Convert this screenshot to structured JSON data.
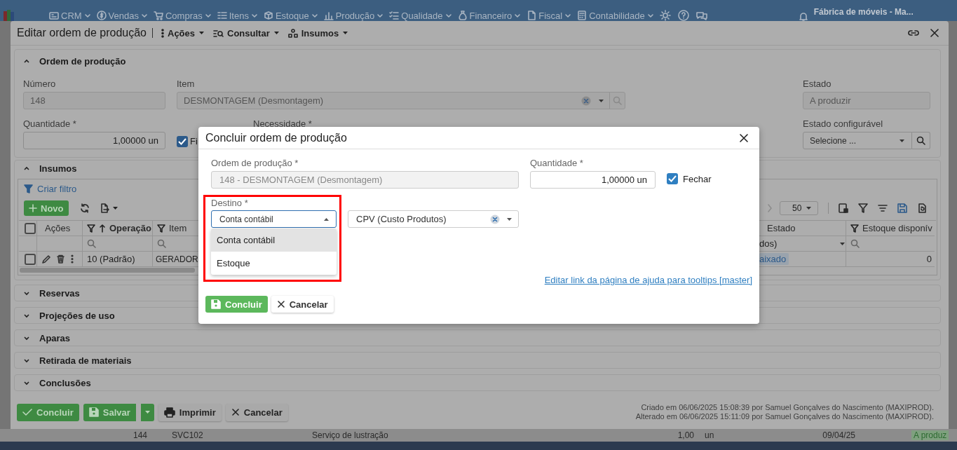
{
  "top_nav": {
    "menu_items": [
      {
        "label": "CRM"
      },
      {
        "label": "Vendas"
      },
      {
        "label": "Compras"
      },
      {
        "label": "Itens"
      },
      {
        "label": "Estoque"
      },
      {
        "label": "Produção"
      },
      {
        "label": "Qualidade"
      },
      {
        "label": "Financeiro"
      },
      {
        "label": "Fiscal"
      },
      {
        "label": "Contabilidade"
      }
    ],
    "company": "Fábrica de móveis - Ma..."
  },
  "window": {
    "title": "Editar ordem de produção",
    "menus": [
      {
        "label": "Ações"
      },
      {
        "label": "Consultar"
      },
      {
        "label": "Insumos"
      }
    ]
  },
  "sections": [
    {
      "title": "Ordem de produção",
      "expanded": true,
      "kind": "order_form",
      "numero": {
        "label": "Número",
        "value": "148"
      },
      "item": {
        "label": "Item",
        "value": "DESMONTAGEM (Desmontagem)"
      },
      "estado": {
        "label": "Estado",
        "value": "A produzir"
      },
      "quantidade": {
        "label": "Quantidade *",
        "value": "1,00000 un"
      },
      "fixed": {
        "label": "Fi",
        "checked": true
      },
      "necessidade": {
        "label": "Necessidade *"
      },
      "estado_configuravel": {
        "label": "Estado configurável",
        "placeholder": "Selecione ..."
      }
    },
    {
      "title": "Insumos",
      "expanded": true,
      "kind": "grid",
      "all_checked": false,
      "filter_link": "Criar filtro",
      "new_button": "Novo",
      "page_size": "50",
      "columns": [
        {
          "label": "Ações",
          "filterable": false,
          "sorted": false
        },
        {
          "label": "Operação",
          "filterable": true,
          "sorted": true
        },
        {
          "label": "Item",
          "filterable": true,
          "sorted": false
        },
        {
          "label": "Estado",
          "filterable": false,
          "sorted": false
        },
        {
          "label": "Estoque disponív",
          "filterable": true,
          "sorted": false
        }
      ],
      "estado_filter": "dos)",
      "rows": [
        {
          "checked": false,
          "operacao": "10 (Padrão)",
          "item": "GERADOR",
          "estado": "aixado",
          "estoque": "0"
        }
      ]
    },
    {
      "title": "Reservas",
      "expanded": false,
      "kind": "collapsed"
    },
    {
      "title": "Projeções de uso",
      "expanded": false,
      "kind": "collapsed"
    },
    {
      "title": "Aparas",
      "expanded": false,
      "kind": "collapsed"
    },
    {
      "title": "Retirada de materiais",
      "expanded": false,
      "kind": "collapsed"
    },
    {
      "title": "Conclusões",
      "expanded": false,
      "kind": "collapsed"
    }
  ],
  "footer": {
    "buttons": [
      {
        "label": "Concluir",
        "kind": "confirm"
      },
      {
        "label": "Salvar",
        "kind": "split"
      },
      {
        "label": "Imprimir",
        "kind": "print"
      },
      {
        "label": "Cancelar",
        "kind": "cancel"
      }
    ],
    "audit": [
      "Criado em 06/06/2025 15:08:39 por Samuel Gonçalves do Nascimento (MAXIPROD).",
      "Alterado em 06/06/2025 15:11:09 por Samuel Gonçalves do Nascimento (MAXIPROD)."
    ]
  },
  "background_row": {
    "cells": [
      "144",
      "SVC102",
      "Serviço de lustração",
      "1,00",
      "un",
      "09/04/25",
      "A produz"
    ]
  },
  "modal": {
    "title": "Concluir ordem de produção",
    "ordem": {
      "label": "Ordem de produção *",
      "value": "148 - DESMONTAGEM (Desmontagem)"
    },
    "quantidade": {
      "label": "Quantidade *",
      "value": "1,00000 un"
    },
    "fechar": {
      "label": "Fechar",
      "checked": true
    },
    "destino": {
      "label": "Destino *",
      "value": "Conta contábil",
      "expanded": true,
      "options": [
        {
          "label": "Conta contábil",
          "selected": true
        },
        {
          "label": "Estoque",
          "selected": false
        }
      ]
    },
    "conta": {
      "value": "CPV (Custo Produtos)"
    },
    "help_link": "Editar link da página de ajuda para tooltips [master]",
    "buttons": [
      {
        "label": "Concluir",
        "kind": "confirm"
      },
      {
        "label": "Cancelar",
        "kind": "cancel"
      }
    ]
  }
}
